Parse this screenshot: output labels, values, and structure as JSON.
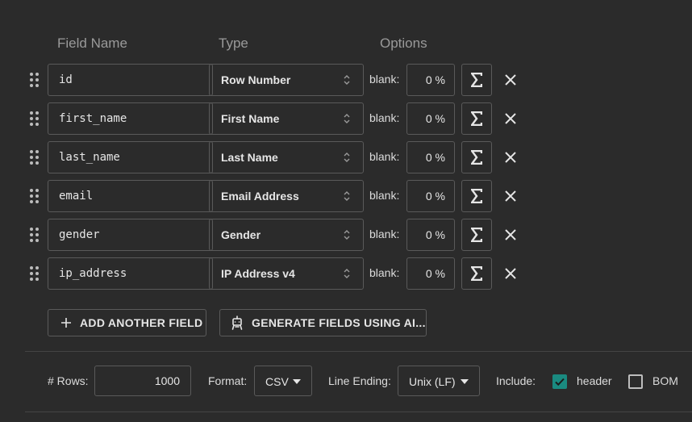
{
  "headers": {
    "field_name": "Field Name",
    "type": "Type",
    "options": "Options"
  },
  "fields": [
    {
      "name": "id",
      "type": "Row Number",
      "blank_label": "blank:",
      "blank_pct": "0 %"
    },
    {
      "name": "first_name",
      "type": "First Name",
      "blank_label": "blank:",
      "blank_pct": "0 %"
    },
    {
      "name": "last_name",
      "type": "Last Name",
      "blank_label": "blank:",
      "blank_pct": "0 %"
    },
    {
      "name": "email",
      "type": "Email Address",
      "blank_label": "blank:",
      "blank_pct": "0 %"
    },
    {
      "name": "gender",
      "type": "Gender",
      "blank_label": "blank:",
      "blank_pct": "0 %"
    },
    {
      "name": "ip_address",
      "type": "IP Address v4",
      "blank_label": "blank:",
      "blank_pct": "0 %"
    }
  ],
  "actions": {
    "add_field": "ADD ANOTHER FIELD",
    "generate_ai": "GENERATE FIELDS USING AI..."
  },
  "footer": {
    "rows_label": "# Rows:",
    "rows_value": "1000",
    "format_label": "Format:",
    "format_value": "CSV",
    "line_ending_label": "Line Ending:",
    "line_ending_value": "Unix (LF)",
    "include_label": "Include:",
    "header_label": "header",
    "header_checked": true,
    "bom_label": "BOM",
    "bom_checked": false
  },
  "colors": {
    "background": "#2b2b2b",
    "accent": "#1a8a80",
    "border": "#5a5a5a"
  },
  "icons": [
    "drag-handle-icon",
    "select-arrows-icon",
    "sigma-icon",
    "close-icon",
    "plus-icon",
    "robot-icon",
    "caret-down-icon",
    "check-icon"
  ]
}
